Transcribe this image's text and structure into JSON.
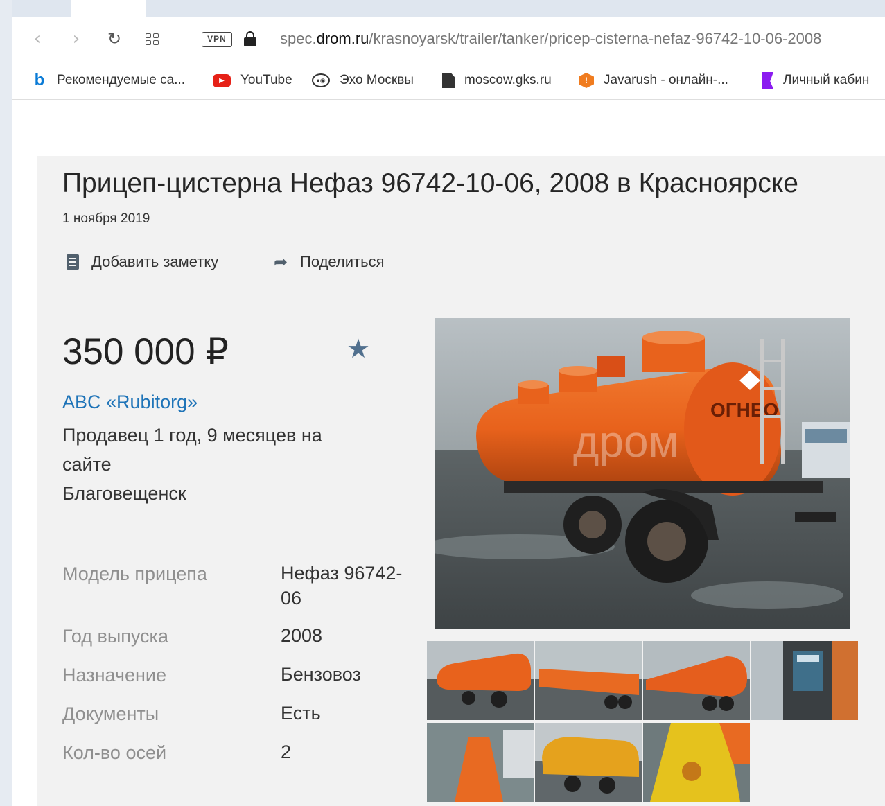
{
  "browser": {
    "url_prefix": "spec.",
    "url_host": "drom.ru",
    "url_path": "/krasnoyarsk/trailer/tanker/pricep-cisterna-nefaz-96742-10-06-2008",
    "vpn_label": "VPN"
  },
  "bookmarks": [
    {
      "label": "Рекомендуемые са...",
      "icon": "bing-icon"
    },
    {
      "label": "YouTube",
      "icon": "youtube-icon"
    },
    {
      "label": "Эхо Москвы",
      "icon": "echo-icon"
    },
    {
      "label": "moscow.gks.ru",
      "icon": "document-icon"
    },
    {
      "label": "Javarush - онлайн-...",
      "icon": "javarush-icon"
    },
    {
      "label": "Личный кабин",
      "icon": "cabinet-icon"
    }
  ],
  "listing": {
    "title": "Прицеп-цистерна Нефаз 96742-10-06, 2008 в Красноярске",
    "date": "1 ноября 2019",
    "add_note": "Добавить заметку",
    "share": "Поделиться",
    "price": "350 000 ₽",
    "seller_name": "ABC «Rubitorg»",
    "seller_since_line1": "Продавец 1 год, 9 месяцев на",
    "seller_since_line2": "сайте",
    "seller_city": "Благовещенск"
  },
  "specs": [
    {
      "label": "Модель прицепа",
      "value_line1": "Нефаз 96742-",
      "value_line2": "06"
    },
    {
      "label": "Год выпуска",
      "value_line1": "2008"
    },
    {
      "label": "Назначение",
      "value_line1": "Бензовоз"
    },
    {
      "label": "Документы",
      "value_line1": "Есть"
    },
    {
      "label": "Кол-во осей",
      "value_line1": "2"
    }
  ],
  "photo_text": {
    "tank_side": "ОГНЕО",
    "watermark": "дром"
  },
  "colors": {
    "link": "#1f74b8",
    "icon_accent": "#51708e",
    "tank_orange": "#e8621c"
  }
}
